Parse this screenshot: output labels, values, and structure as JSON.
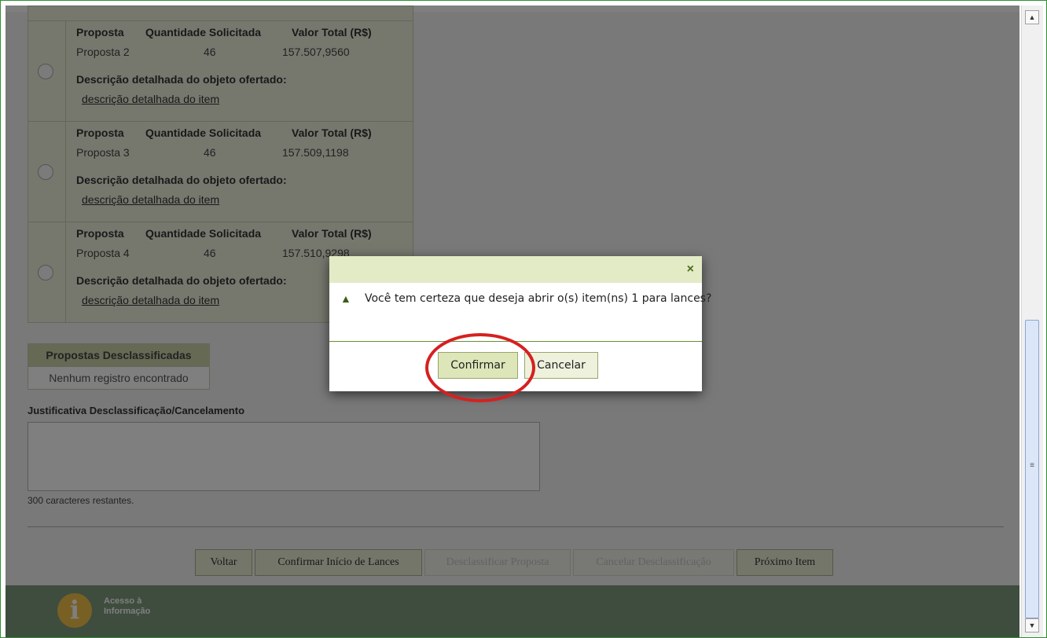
{
  "proposals": {
    "headers": {
      "proposta": "Proposta",
      "quantidade": "Quantidade Solicitada",
      "valor": "Valor Total (R$)"
    },
    "rows": [
      {
        "name": "Proposta 2",
        "quantity": "46",
        "value": "157.507,9560",
        "desc_label": "Descrição detalhada do objeto ofertado:",
        "desc_link": "descrição detalhada do item"
      },
      {
        "name": "Proposta 3",
        "quantity": "46",
        "value": "157.509,1198",
        "desc_label": "Descrição detalhada do objeto ofertado:",
        "desc_link": "descrição detalhada do item"
      },
      {
        "name": "Proposta 4",
        "quantity": "46",
        "value": "157.510,9298",
        "desc_label": "Descrição detalhada do objeto ofertado:",
        "desc_link": "descrição detalhada do item"
      }
    ]
  },
  "disqualified": {
    "header": "Propostas Desclassificadas",
    "empty": "Nenhum registro encontrado"
  },
  "justification": {
    "label": "Justificativa Desclassificação/Cancelamento",
    "remaining": "300 caracteres restantes."
  },
  "buttons": {
    "back": "Voltar",
    "confirm_start": "Confirmar Início de Lances",
    "disqualify": "Desclassificar Proposta",
    "cancel_disq": "Cancelar Desclassificação",
    "next": "Próximo Item"
  },
  "footer": {
    "logo_line1": "Acesso à",
    "logo_line2": "Informação",
    "logo_letter": "i"
  },
  "modal": {
    "message": "Você tem certeza que deseja abrir o(s) item(ns) 1 para lances?",
    "confirm": "Confirmar",
    "cancel": "Cancelar",
    "close_icon": "×",
    "warning_icon": "▲"
  },
  "colors": {
    "accent": "#4a6e1a",
    "highlight_ring": "#d62020",
    "footer": "#4f6a4f"
  }
}
